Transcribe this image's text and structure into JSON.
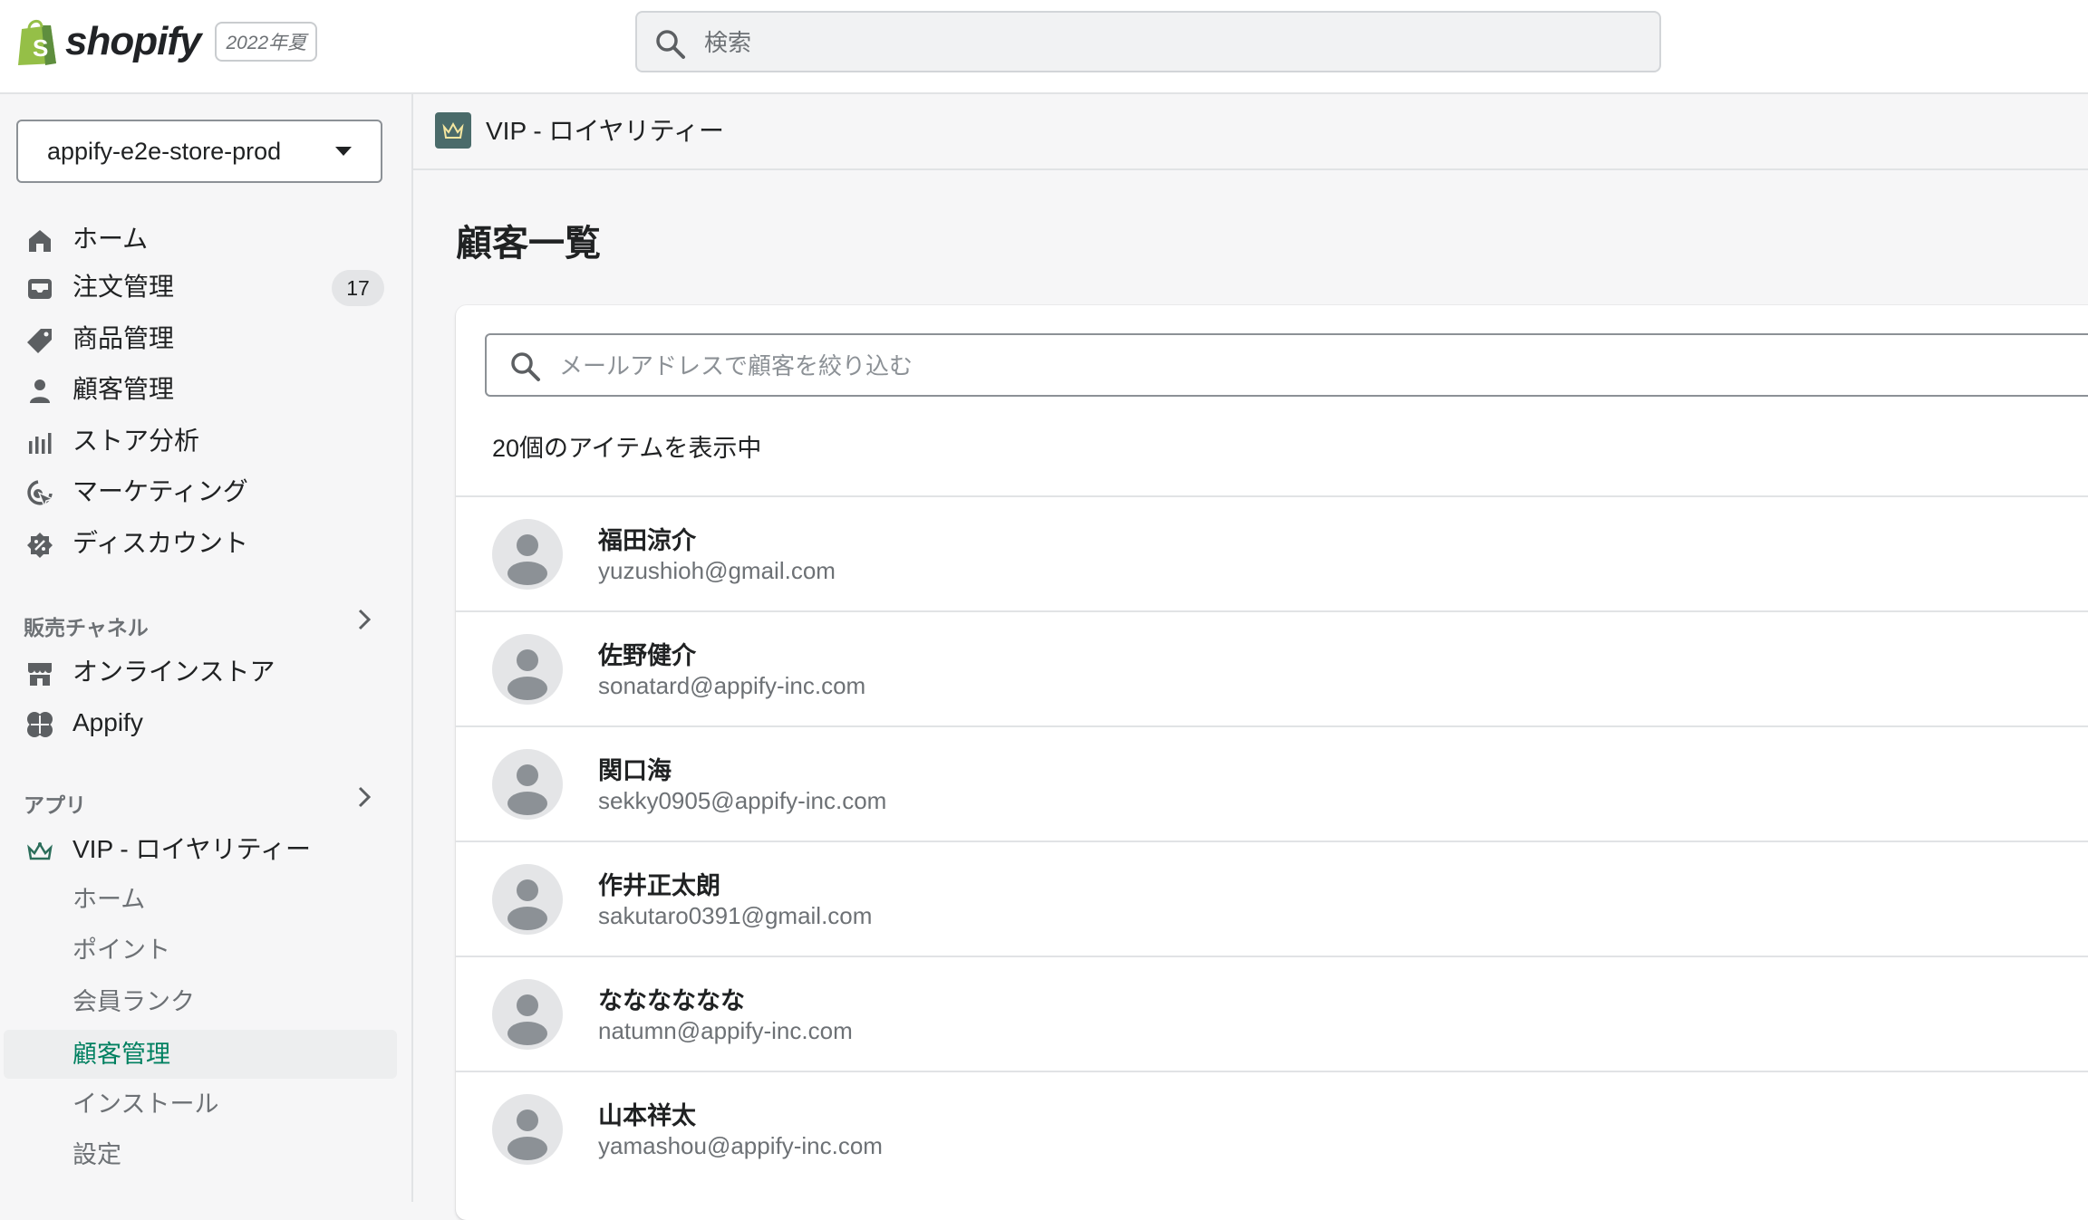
{
  "header": {
    "brand": "shopify",
    "edition": "2022年夏",
    "search_placeholder": "検索"
  },
  "sidebar": {
    "store_name": "appify-e2e-store-prod",
    "nav": [
      {
        "label": "ホーム",
        "icon": "home-icon"
      },
      {
        "label": "注文管理",
        "icon": "inbox-icon",
        "badge": "17"
      },
      {
        "label": "商品管理",
        "icon": "tag-icon"
      },
      {
        "label": "顧客管理",
        "icon": "person-icon"
      },
      {
        "label": "ストア分析",
        "icon": "bar-chart-icon"
      },
      {
        "label": "マーケティング",
        "icon": "target-icon"
      },
      {
        "label": "ディスカウント",
        "icon": "discount-icon"
      }
    ],
    "sales_channels": {
      "title": "販売チャネル",
      "items": [
        {
          "label": "オンラインストア",
          "icon": "store-icon"
        },
        {
          "label": "Appify",
          "icon": "appify-icon"
        }
      ]
    },
    "apps": {
      "title": "アプリ",
      "app_label": "VIP - ロイヤリティー",
      "app_icon": "crown-icon",
      "sub_items": [
        {
          "label": "ホーム"
        },
        {
          "label": "ポイント"
        },
        {
          "label": "会員ランク"
        },
        {
          "label": "顧客管理",
          "active": true
        },
        {
          "label": "インストール"
        },
        {
          "label": "設定"
        }
      ]
    }
  },
  "app_bar": {
    "title": "VIP - ロイヤリティー"
  },
  "main": {
    "page_title": "顧客一覧",
    "filter_placeholder": "メールアドレスで顧客を絞り込む",
    "count_text": "20個のアイテムを表示中",
    "customers": [
      {
        "name": "福田涼介",
        "email": "yuzushioh@gmail.com"
      },
      {
        "name": "佐野健介",
        "email": "sonatard@appify-inc.com"
      },
      {
        "name": "関口海",
        "email": "sekky0905@appify-inc.com"
      },
      {
        "name": "作井正太朗",
        "email": "sakutaro0391@gmail.com"
      },
      {
        "name": "なななななな",
        "email": "natumn@appify-inc.com"
      },
      {
        "name": "山本祥太",
        "email": "yamashou@appify-inc.com"
      }
    ]
  },
  "colors": {
    "brand_green": "#95bf47",
    "accent_active": "#008060",
    "badge_bg": "#e4e5e7",
    "app_icon_bg": "#4a6b6a"
  }
}
